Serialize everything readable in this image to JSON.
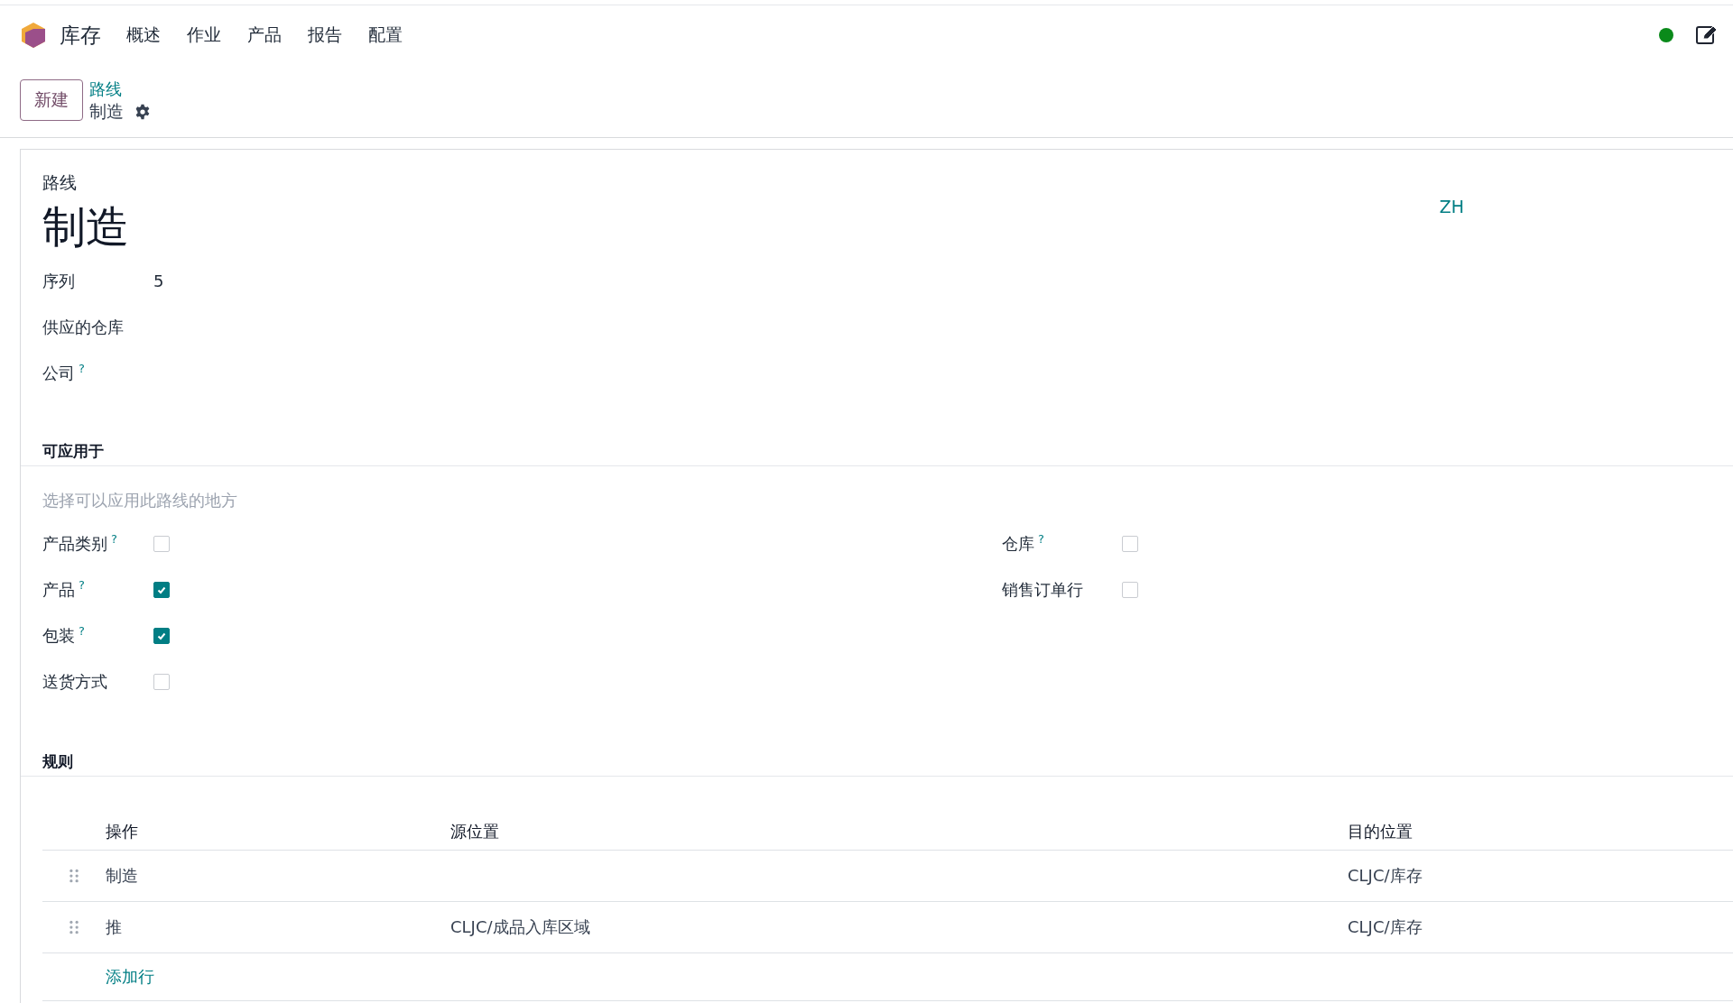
{
  "navbar": {
    "app_name": "库存",
    "menu": [
      "概述",
      "作业",
      "产品",
      "报告",
      "配置"
    ]
  },
  "control_panel": {
    "new_button": "新建",
    "breadcrumb": "路线",
    "record_name": "制造"
  },
  "form": {
    "overline": "路线",
    "title": "制造",
    "language": "ZH",
    "fields": [
      {
        "label": "序列",
        "value": "5"
      },
      {
        "label": "供应的仓库"
      },
      {
        "label": "公司",
        "help": "?"
      }
    ]
  },
  "applicable": {
    "title": "可应用于",
    "hint": "选择可以应用此路线的地方",
    "left": [
      {
        "label": "产品类别",
        "help": "?",
        "checked": false
      },
      {
        "label": "产品",
        "help": "?",
        "checked": true
      },
      {
        "label": "包装",
        "help": "?",
        "checked": true
      },
      {
        "label": "送货方式",
        "checked": false
      }
    ],
    "right": [
      {
        "label": "仓库",
        "help": "?",
        "checked": false
      },
      {
        "label": "销售订单行",
        "checked": false
      }
    ]
  },
  "rules": {
    "title": "规则",
    "columns": [
      "操作",
      "源位置",
      "目的位置"
    ],
    "rows": [
      {
        "action": "制造",
        "destination": "CLJC/库存"
      },
      {
        "action": "推",
        "source": "CLJC/成品入库区域",
        "destination": "CLJC/库存"
      }
    ],
    "add_line": "添加行"
  }
}
